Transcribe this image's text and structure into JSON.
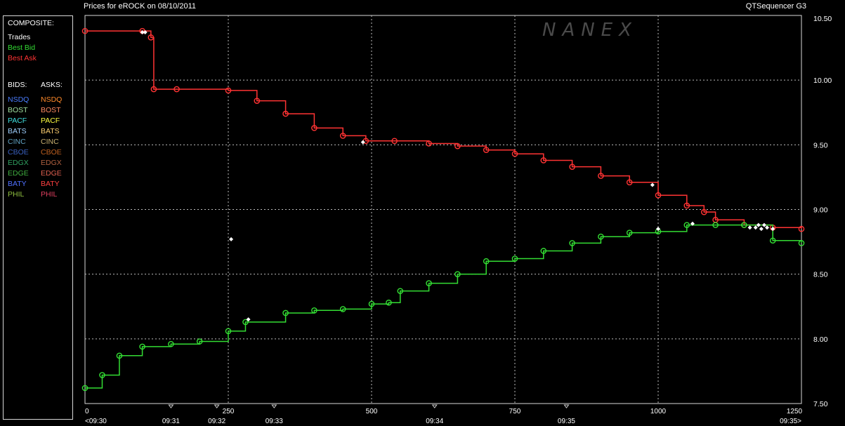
{
  "header": {
    "title_left": "Prices for  eROCK  on  08/10/2011",
    "title_right": "QTSequencer G3",
    "watermark": "NANEX"
  },
  "legend": {
    "composite_title": "COMPOSITE:",
    "composite": [
      {
        "label": "Trades",
        "color": "#ffffff"
      },
      {
        "label": "Best Bid",
        "color": "#33dd33"
      },
      {
        "label": "Best Ask",
        "color": "#ff3333"
      }
    ],
    "bids_title": "BIDS:",
    "asks_title": "ASKS:",
    "exchanges": [
      {
        "bid": "NSDQ",
        "bid_color": "#4a7dff",
        "ask": "NSDQ",
        "ask_color": "#ff8a2a"
      },
      {
        "bid": "BOST",
        "bid_color": "#a0e0a0",
        "ask": "BOST",
        "ask_color": "#ff8a60"
      },
      {
        "bid": "PACF",
        "bid_color": "#40e0e0",
        "ask": "PACF",
        "ask_color": "#ffff40"
      },
      {
        "bid": "BATS",
        "bid_color": "#9fd0ff",
        "ask": "BATS",
        "ask_color": "#ffd070"
      },
      {
        "bid": "CINC",
        "bid_color": "#60a0c0",
        "ask": "CINC",
        "ask_color": "#c8b070"
      },
      {
        "bid": "CBOE",
        "bid_color": "#3a60c0",
        "ask": "CBOE",
        "ask_color": "#c06020"
      },
      {
        "bid": "EDGX",
        "bid_color": "#30a060",
        "ask": "EDGX",
        "ask_color": "#b06040"
      },
      {
        "bid": "EDGE",
        "bid_color": "#40b040",
        "ask": "EDGE",
        "ask_color": "#e06050"
      },
      {
        "bid": "BATY",
        "bid_color": "#5070ff",
        "ask": "BATY",
        "ask_color": "#ff4040"
      },
      {
        "bid": "PHIL",
        "bid_color": "#90c040",
        "ask": "PHIL",
        "ask_color": "#e04060"
      }
    ]
  },
  "chart_data": {
    "type": "line",
    "title": "Prices for  eROCK  on  08/10/2011",
    "x_ticks": [
      "0",
      "250",
      "500",
      "750",
      "1000",
      "1250"
    ],
    "time_labels": [
      "<09:30",
      "09:31",
      "09:32",
      "09:33",
      "09:34",
      "09:35",
      "09:35>"
    ],
    "time_label_seq": [
      0,
      150,
      230,
      330,
      610,
      840,
      1250
    ],
    "xlim": [
      0,
      1250
    ],
    "y_ticks": [
      "10.50",
      "10.00",
      "9.50",
      "9.00",
      "8.50",
      "8.00",
      "7.50"
    ],
    "ylim": [
      7.5,
      10.5
    ],
    "grid": true,
    "series": [
      {
        "name": "Best Ask",
        "color": "#ff3333",
        "x": [
          0,
          100,
          115,
          120,
          160,
          250,
          300,
          350,
          400,
          450,
          490,
          540,
          600,
          650,
          700,
          750,
          800,
          850,
          900,
          950,
          1000,
          1050,
          1080,
          1100,
          1150,
          1200,
          1250
        ],
        "y": [
          10.38,
          10.38,
          10.33,
          9.93,
          9.93,
          9.92,
          9.84,
          9.74,
          9.63,
          9.57,
          9.53,
          9.53,
          9.51,
          9.49,
          9.46,
          9.43,
          9.38,
          9.33,
          9.26,
          9.21,
          9.11,
          9.03,
          8.98,
          8.92,
          8.88,
          8.86,
          8.85
        ]
      },
      {
        "name": "Best Bid",
        "color": "#33dd33",
        "x": [
          0,
          30,
          60,
          100,
          150,
          200,
          250,
          280,
          350,
          400,
          450,
          500,
          530,
          550,
          600,
          650,
          700,
          750,
          800,
          850,
          900,
          950,
          1000,
          1050,
          1100,
          1150,
          1200,
          1250
        ],
        "y": [
          7.62,
          7.72,
          7.87,
          7.94,
          7.96,
          7.98,
          8.06,
          8.13,
          8.2,
          8.22,
          8.23,
          8.27,
          8.28,
          8.37,
          8.43,
          8.5,
          8.6,
          8.62,
          8.68,
          8.74,
          8.79,
          8.82,
          8.83,
          8.88,
          8.88,
          8.88,
          8.76,
          8.74
        ]
      },
      {
        "name": "Trades",
        "color": "#ffffff",
        "x": [
          100,
          105,
          255,
          285,
          485,
          990,
          1000,
          1060,
          1160,
          1170,
          1175,
          1180,
          1185,
          1190,
          1200
        ],
        "y": [
          10.37,
          10.37,
          8.77,
          8.15,
          9.52,
          9.19,
          8.85,
          8.89,
          8.86,
          8.86,
          8.88,
          8.85,
          8.88,
          8.86,
          8.85
        ]
      }
    ]
  }
}
